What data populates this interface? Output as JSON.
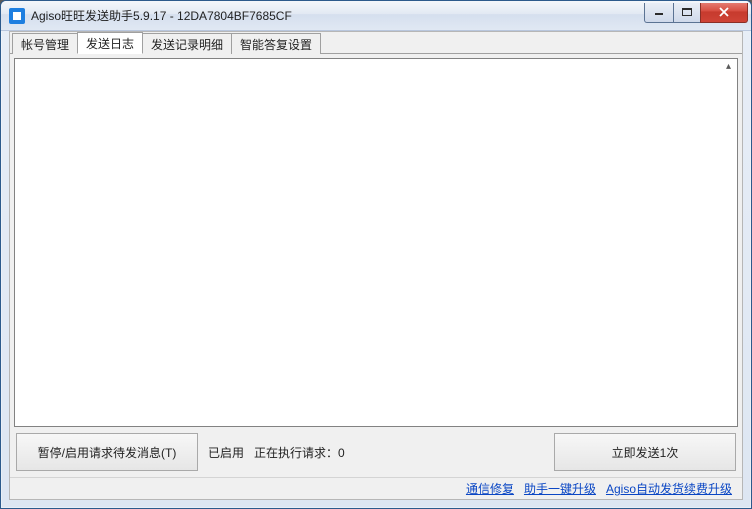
{
  "window": {
    "title": "Agiso旺旺发送助手5.9.17 - 12DA7804BF7685CF"
  },
  "tabs": [
    {
      "label": "帐号管理"
    },
    {
      "label": "发送日志"
    },
    {
      "label": "发送记录明细"
    },
    {
      "label": "智能答复设置"
    }
  ],
  "buttons": {
    "pause_toggle": "暂停/启用请求待发消息(T)",
    "send_now": "立即发送1次"
  },
  "status": {
    "enabled_label": "已启用",
    "executing_label": "正在执行请求：",
    "executing_count": "0"
  },
  "footer_links": {
    "comm_repair": "通信修复",
    "assistant_upgrade": "助手一键升级",
    "agiso_renew": "Agiso自动发货续费升级"
  }
}
